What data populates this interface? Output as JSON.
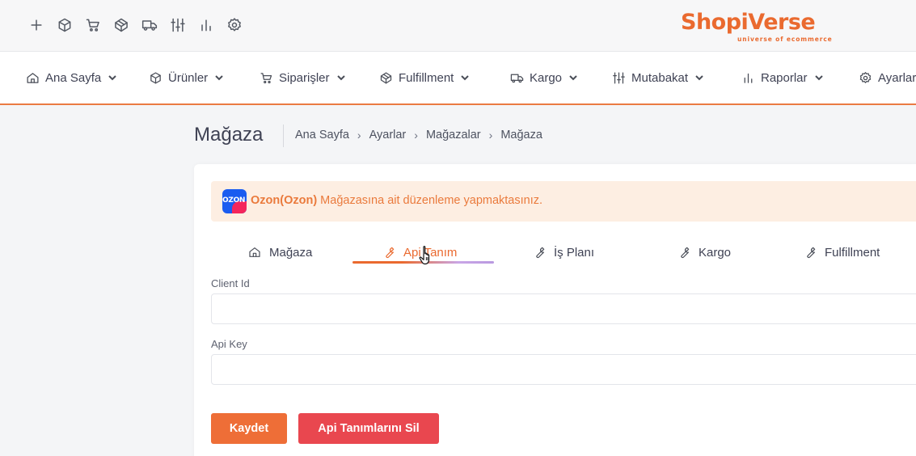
{
  "toolbar": {
    "quick_icons": [
      "plus-icon",
      "box-icon",
      "cart-icon",
      "fulfillment-cube-icon",
      "truck-icon",
      "sliders-icon",
      "bar-chart-icon",
      "gear-icon"
    ]
  },
  "logo": {
    "text": "ShopiVerse",
    "tagline": "universe of ecommerce",
    "color": "#ea6a2f"
  },
  "nav": {
    "items": [
      {
        "label": "Ana Sayfa",
        "icon": "home-icon"
      },
      {
        "label": "Ürünler",
        "icon": "box-icon"
      },
      {
        "label": "Siparişler",
        "icon": "cart-icon"
      },
      {
        "label": "Fulfillment",
        "icon": "fulfillment-cube-icon"
      },
      {
        "label": "Kargo",
        "icon": "truck-icon"
      },
      {
        "label": "Mutabakat",
        "icon": "sliders-icon"
      },
      {
        "label": "Raporlar",
        "icon": "bar-chart-icon"
      },
      {
        "label": "Ayarlar",
        "icon": "gear-icon"
      }
    ],
    "accent_color": "#ea7a43"
  },
  "page": {
    "title": "Mağaza",
    "breadcrumb": [
      "Ana Sayfa",
      "Ayarlar",
      "Mağazalar",
      "Mağaza"
    ]
  },
  "alert": {
    "store_logo_text": "OZON",
    "store_name": "Ozon(Ozon)",
    "message": " Mağazasına ait düzenleme yapmaktasınız."
  },
  "tabs": [
    {
      "label": "Mağaza",
      "icon": "home-icon",
      "active": false
    },
    {
      "label": "Api Tanım",
      "icon": "wrench-icon",
      "active": true
    },
    {
      "label": "İş Planı",
      "icon": "wrench-icon",
      "active": false
    },
    {
      "label": "Kargo",
      "icon": "wrench-icon",
      "active": false
    },
    {
      "label": "Fulfillment",
      "icon": "wrench-icon",
      "active": false
    }
  ],
  "form": {
    "client_id_label": "Client Id",
    "client_id_value": "",
    "api_key_label": "Api Key",
    "api_key_value": ""
  },
  "buttons": {
    "save": "Kaydet",
    "delete": "Api Tanımlarını Sil",
    "save_color": "#ee6e37",
    "delete_color": "#e9474f"
  }
}
